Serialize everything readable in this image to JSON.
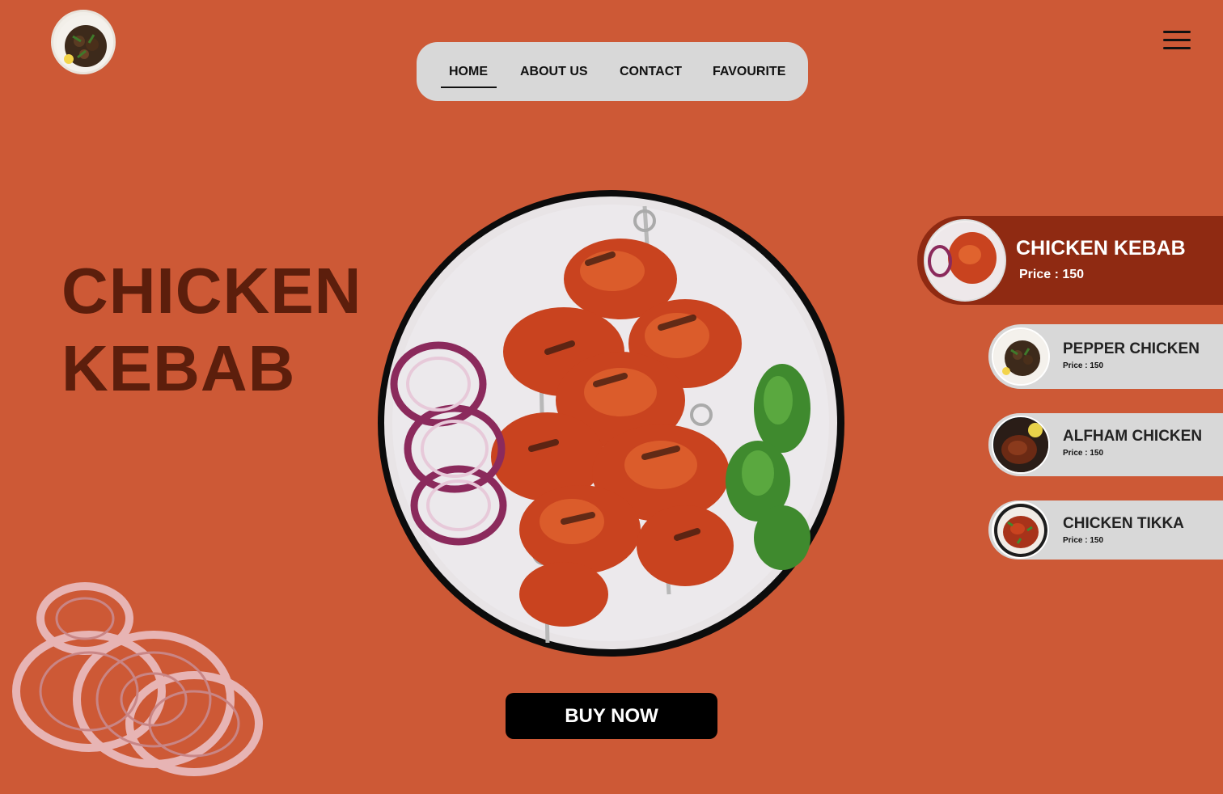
{
  "nav": {
    "items": [
      {
        "label": "HOME",
        "active": true
      },
      {
        "label": "ABOUT US"
      },
      {
        "label": "CONTACT"
      },
      {
        "label": "FAVOURITE"
      }
    ]
  },
  "hero": {
    "title_line1": "CHICKEN",
    "title_line2": "KEBAB",
    "buy_label": "BUY NOW"
  },
  "menu": {
    "items": [
      {
        "name": "CHICKEN KEBAB",
        "price": "Price : 150",
        "selected": true
      },
      {
        "name": "PEPPER CHICKEN",
        "price": "Price : 150"
      },
      {
        "name": "ALFHAM CHICKEN",
        "price": "Price : 150"
      },
      {
        "name": "CHICKEN TIKKA",
        "price": "Price : 150"
      }
    ]
  },
  "colors": {
    "background": "#cd5936",
    "title": "#5c1e0c",
    "active_card": "#8f2a12",
    "nav_bg": "#d8d8d8",
    "button": "#000000"
  },
  "icons": {
    "menu": "hamburger-menu-icon",
    "logo": "food-plate-logo"
  }
}
